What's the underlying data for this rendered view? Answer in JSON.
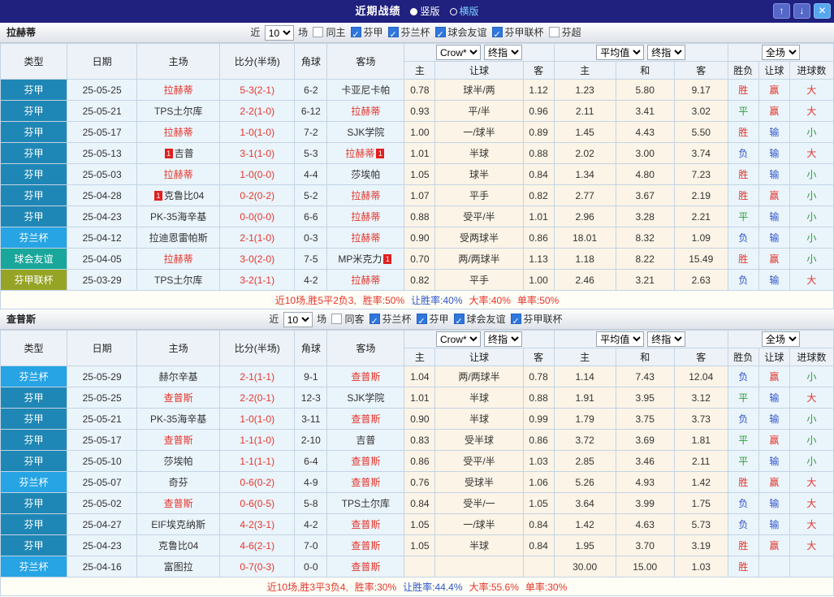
{
  "titlebar": {
    "title": "近期战绩",
    "vertical": "竖版",
    "horizontal": "横版",
    "up_icon": "↑",
    "down_icon": "↓",
    "close_icon": "✕"
  },
  "table_header": {
    "type": "类型",
    "date": "日期",
    "home": "主场",
    "score": "比分(半场)",
    "corner": "角球",
    "away": "客场",
    "crow": "Crow*",
    "final": "终指",
    "avg": "平均值",
    "scope": "全场",
    "h": "主",
    "handicap": "让球",
    "a": "客",
    "d": "和",
    "wdl": "胜负",
    "hc": "让球",
    "goals": "进球数"
  },
  "sections": [
    {
      "team": "拉赫蒂",
      "filter": {
        "near": "近",
        "count": "10",
        "games": "场",
        "checks": [
          {
            "label": "同主",
            "box_cls": ""
          },
          {
            "label": "芬甲",
            "box_cls": "on"
          },
          {
            "label": "芬兰杯",
            "box_cls": "on"
          },
          {
            "label": "球会友谊",
            "box_cls": "on"
          },
          {
            "label": "芬甲联杯",
            "box_cls": "on"
          },
          {
            "label": "芬超",
            "box_cls": ""
          }
        ]
      },
      "rows": [
        {
          "type": "芬甲",
          "type_cls": "tp-fj",
          "date": "25-05-25",
          "home": "拉赫蒂",
          "home_cls": "t-red",
          "home_card": "",
          "score": "5-3(2-1)",
          "corner": "6-2",
          "away": "卡亚尼卡帕",
          "away_cls": "",
          "away_card": "",
          "ch": "0.78",
          "hcap": "球半/两",
          "ca": "1.12",
          "ah": "1.23",
          "ad": "5.80",
          "aa": "9.17",
          "wdl": "胜",
          "wdl_cls": "c-red",
          "hc": "赢",
          "hc_cls": "c-red",
          "ou": "大",
          "ou_cls": "c-red"
        },
        {
          "type": "芬甲",
          "type_cls": "tp-fj",
          "date": "25-05-21",
          "home": "TPS土尔库",
          "home_cls": "",
          "home_card": "",
          "score": "2-2(1-0)",
          "corner": "6-12",
          "away": "拉赫蒂",
          "away_cls": "t-red",
          "away_card": "",
          "ch": "0.93",
          "hcap": "平/半",
          "ca": "0.96",
          "ah": "2.11",
          "ad": "3.41",
          "aa": "3.02",
          "wdl": "平",
          "wdl_cls": "c-green",
          "hc": "赢",
          "hc_cls": "c-red",
          "ou": "大",
          "ou_cls": "c-red"
        },
        {
          "type": "芬甲",
          "type_cls": "tp-fj",
          "date": "25-05-17",
          "home": "拉赫蒂",
          "home_cls": "t-red",
          "home_card": "",
          "score": "1-0(1-0)",
          "corner": "7-2",
          "away": "SJK学院",
          "away_cls": "",
          "away_card": "",
          "ch": "1.00",
          "hcap": "一/球半",
          "ca": "0.89",
          "ah": "1.45",
          "ad": "4.43",
          "aa": "5.50",
          "wdl": "胜",
          "wdl_cls": "c-red",
          "hc": "输",
          "hc_cls": "c-blue",
          "ou": "小",
          "ou_cls": "c-green"
        },
        {
          "type": "芬甲",
          "type_cls": "tp-fj",
          "date": "25-05-13",
          "home": "吉普",
          "home_cls": "",
          "home_card": "1",
          "score": "3-1(1-0)",
          "corner": "5-3",
          "away": "拉赫蒂",
          "away_cls": "t-red",
          "away_card": "1",
          "ch": "1.01",
          "hcap": "半球",
          "ca": "0.88",
          "ah": "2.02",
          "ad": "3.00",
          "aa": "3.74",
          "wdl": "负",
          "wdl_cls": "c-blue",
          "hc": "输",
          "hc_cls": "c-blue",
          "ou": "大",
          "ou_cls": "c-red"
        },
        {
          "type": "芬甲",
          "type_cls": "tp-fj",
          "date": "25-05-03",
          "home": "拉赫蒂",
          "home_cls": "t-red",
          "home_card": "",
          "score": "1-0(0-0)",
          "corner": "4-4",
          "away": "莎埃帕",
          "away_cls": "",
          "away_card": "",
          "ch": "1.05",
          "hcap": "球半",
          "ca": "0.84",
          "ah": "1.34",
          "ad": "4.80",
          "aa": "7.23",
          "wdl": "胜",
          "wdl_cls": "c-red",
          "hc": "输",
          "hc_cls": "c-blue",
          "ou": "小",
          "ou_cls": "c-green"
        },
        {
          "type": "芬甲",
          "type_cls": "tp-fj",
          "date": "25-04-28",
          "home": "克鲁比04",
          "home_cls": "",
          "home_card": "1",
          "score": "0-2(0-2)",
          "corner": "5-2",
          "away": "拉赫蒂",
          "away_cls": "t-red",
          "away_card": "",
          "ch": "1.07",
          "hcap": "平手",
          "ca": "0.82",
          "ah": "2.77",
          "ad": "3.67",
          "aa": "2.19",
          "wdl": "胜",
          "wdl_cls": "c-red",
          "hc": "赢",
          "hc_cls": "c-red",
          "ou": "小",
          "ou_cls": "c-green"
        },
        {
          "type": "芬甲",
          "type_cls": "tp-fj",
          "date": "25-04-23",
          "home": "PK-35海辛基",
          "home_cls": "",
          "home_card": "",
          "score": "0-0(0-0)",
          "corner": "6-6",
          "away": "拉赫蒂",
          "away_cls": "t-red",
          "away_card": "",
          "ch": "0.88",
          "hcap": "受平/半",
          "ca": "1.01",
          "ah": "2.96",
          "ad": "3.28",
          "aa": "2.21",
          "wdl": "平",
          "wdl_cls": "c-green",
          "hc": "输",
          "hc_cls": "c-blue",
          "ou": "小",
          "ou_cls": "c-green"
        },
        {
          "type": "芬兰杯",
          "type_cls": "tp-flb",
          "date": "25-04-12",
          "home": "拉迪恩雷帕斯",
          "home_cls": "",
          "home_card": "",
          "score": "2-1(1-0)",
          "corner": "0-3",
          "away": "拉赫蒂",
          "away_cls": "t-red",
          "away_card": "",
          "ch": "0.90",
          "hcap": "受两球半",
          "ca": "0.86",
          "ah": "18.01",
          "ad": "8.32",
          "aa": "1.09",
          "wdl": "负",
          "wdl_cls": "c-blue",
          "hc": "输",
          "hc_cls": "c-blue",
          "ou": "小",
          "ou_cls": "c-green"
        },
        {
          "type": "球会友谊",
          "type_cls": "tp-qhyy",
          "date": "25-04-05",
          "home": "拉赫蒂",
          "home_cls": "t-red",
          "home_card": "",
          "score": "3-0(2-0)",
          "corner": "7-5",
          "away": "MP米克力",
          "away_cls": "",
          "away_card": "1",
          "ch": "0.70",
          "hcap": "两/两球半",
          "ca": "1.13",
          "ah": "1.18",
          "ad": "8.22",
          "aa": "15.49",
          "wdl": "胜",
          "wdl_cls": "c-red",
          "hc": "赢",
          "hc_cls": "c-red",
          "ou": "小",
          "ou_cls": "c-green"
        },
        {
          "type": "芬甲联杯",
          "type_cls": "tp-fjlb",
          "date": "25-03-29",
          "home": "TPS土尔库",
          "home_cls": "",
          "home_card": "",
          "score": "3-2(1-1)",
          "corner": "4-2",
          "away": "拉赫蒂",
          "away_cls": "t-red",
          "away_card": "",
          "ch": "0.82",
          "hcap": "平手",
          "ca": "1.00",
          "ah": "2.46",
          "ad": "3.21",
          "aa": "2.63",
          "wdl": "负",
          "wdl_cls": "c-blue",
          "hc": "输",
          "hc_cls": "c-blue",
          "ou": "大",
          "ou_cls": "c-red"
        }
      ],
      "summary": [
        {
          "text": "近10场,胜5平2负3,",
          "cls": "c-red"
        },
        {
          "text": "胜率:50%",
          "cls": "c-red"
        },
        {
          "text": "让胜率:40%",
          "cls": "c-blue"
        },
        {
          "text": "大率:40%",
          "cls": "c-red"
        },
        {
          "text": "单率:50%",
          "cls": "c-red"
        }
      ]
    },
    {
      "team": "查普斯",
      "filter": {
        "near": "近",
        "count": "10",
        "games": "场",
        "checks": [
          {
            "label": "同客",
            "box_cls": ""
          },
          {
            "label": "芬兰杯",
            "box_cls": "on"
          },
          {
            "label": "芬甲",
            "box_cls": "on"
          },
          {
            "label": "球会友谊",
            "box_cls": "on"
          },
          {
            "label": "芬甲联杯",
            "box_cls": "on"
          }
        ]
      },
      "rows": [
        {
          "type": "芬兰杯",
          "type_cls": "tp-flb",
          "date": "25-05-29",
          "home": "赫尔辛基",
          "home_cls": "",
          "home_card": "",
          "score": "2-1(1-1)",
          "corner": "9-1",
          "away": "查普斯",
          "away_cls": "t-red",
          "away_card": "",
          "ch": "1.04",
          "hcap": "两/两球半",
          "ca": "0.78",
          "ah": "1.14",
          "ad": "7.43",
          "aa": "12.04",
          "wdl": "负",
          "wdl_cls": "c-blue",
          "hc": "赢",
          "hc_cls": "c-red",
          "ou": "小",
          "ou_cls": "c-green"
        },
        {
          "type": "芬甲",
          "type_cls": "tp-fj",
          "date": "25-05-25",
          "home": "查普斯",
          "home_cls": "t-red",
          "home_card": "",
          "score": "2-2(0-1)",
          "corner": "12-3",
          "away": "SJK学院",
          "away_cls": "",
          "away_card": "",
          "ch": "1.01",
          "hcap": "半球",
          "ca": "0.88",
          "ah": "1.91",
          "ad": "3.95",
          "aa": "3.12",
          "wdl": "平",
          "wdl_cls": "c-green",
          "hc": "输",
          "hc_cls": "c-blue",
          "ou": "大",
          "ou_cls": "c-red"
        },
        {
          "type": "芬甲",
          "type_cls": "tp-fj",
          "date": "25-05-21",
          "home": "PK-35海辛基",
          "home_cls": "",
          "home_card": "",
          "score": "1-0(1-0)",
          "corner": "3-11",
          "away": "查普斯",
          "away_cls": "t-red",
          "away_card": "",
          "ch": "0.90",
          "hcap": "半球",
          "ca": "0.99",
          "ah": "1.79",
          "ad": "3.75",
          "aa": "3.73",
          "wdl": "负",
          "wdl_cls": "c-blue",
          "hc": "输",
          "hc_cls": "c-blue",
          "ou": "小",
          "ou_cls": "c-green"
        },
        {
          "type": "芬甲",
          "type_cls": "tp-fj",
          "date": "25-05-17",
          "home": "查普斯",
          "home_cls": "t-red",
          "home_card": "",
          "score": "1-1(1-0)",
          "corner": "2-10",
          "away": "吉普",
          "away_cls": "",
          "away_card": "",
          "ch": "0.83",
          "hcap": "受半球",
          "ca": "0.86",
          "ah": "3.72",
          "ad": "3.69",
          "aa": "1.81",
          "wdl": "平",
          "wdl_cls": "c-green",
          "hc": "赢",
          "hc_cls": "c-red",
          "ou": "小",
          "ou_cls": "c-green"
        },
        {
          "type": "芬甲",
          "type_cls": "tp-fj",
          "date": "25-05-10",
          "home": "莎埃帕",
          "home_cls": "",
          "home_card": "",
          "score": "1-1(1-1)",
          "corner": "6-4",
          "away": "查普斯",
          "away_cls": "t-red",
          "away_card": "",
          "ch": "0.86",
          "hcap": "受平/半",
          "ca": "1.03",
          "ah": "2.85",
          "ad": "3.46",
          "aa": "2.11",
          "wdl": "平",
          "wdl_cls": "c-green",
          "hc": "输",
          "hc_cls": "c-blue",
          "ou": "小",
          "ou_cls": "c-green"
        },
        {
          "type": "芬兰杯",
          "type_cls": "tp-flb",
          "date": "25-05-07",
          "home": "奇芬",
          "home_cls": "",
          "home_card": "",
          "score": "0-6(0-2)",
          "corner": "4-9",
          "away": "查普斯",
          "away_cls": "t-red",
          "away_card": "",
          "ch": "0.76",
          "hcap": "受球半",
          "ca": "1.06",
          "ah": "5.26",
          "ad": "4.93",
          "aa": "1.42",
          "wdl": "胜",
          "wdl_cls": "c-red",
          "hc": "赢",
          "hc_cls": "c-red",
          "ou": "大",
          "ou_cls": "c-red"
        },
        {
          "type": "芬甲",
          "type_cls": "tp-fj",
          "date": "25-05-02",
          "home": "查普斯",
          "home_cls": "t-red",
          "home_card": "",
          "score": "0-6(0-5)",
          "corner": "5-8",
          "away": "TPS土尔库",
          "away_cls": "",
          "away_card": "",
          "ch": "0.84",
          "hcap": "受半/一",
          "ca": "1.05",
          "ah": "3.64",
          "ad": "3.99",
          "aa": "1.75",
          "wdl": "负",
          "wdl_cls": "c-blue",
          "hc": "输",
          "hc_cls": "c-blue",
          "ou": "大",
          "ou_cls": "c-red"
        },
        {
          "type": "芬甲",
          "type_cls": "tp-fj",
          "date": "25-04-27",
          "home": "EIF埃克纳斯",
          "home_cls": "",
          "home_card": "",
          "score": "4-2(3-1)",
          "corner": "4-2",
          "away": "查普斯",
          "away_cls": "t-red",
          "away_card": "",
          "ch": "1.05",
          "hcap": "一/球半",
          "ca": "0.84",
          "ah": "1.42",
          "ad": "4.63",
          "aa": "5.73",
          "wdl": "负",
          "wdl_cls": "c-blue",
          "hc": "输",
          "hc_cls": "c-blue",
          "ou": "大",
          "ou_cls": "c-red"
        },
        {
          "type": "芬甲",
          "type_cls": "tp-fj",
          "date": "25-04-23",
          "home": "克鲁比04",
          "home_cls": "",
          "home_card": "",
          "score": "4-6(2-1)",
          "corner": "7-0",
          "away": "查普斯",
          "away_cls": "t-red",
          "away_card": "",
          "ch": "1.05",
          "hcap": "半球",
          "ca": "0.84",
          "ah": "1.95",
          "ad": "3.70",
          "aa": "3.19",
          "wdl": "胜",
          "wdl_cls": "c-red",
          "hc": "赢",
          "hc_cls": "c-red",
          "ou": "大",
          "ou_cls": "c-red"
        },
        {
          "type": "芬兰杯",
          "type_cls": "tp-flb",
          "date": "25-04-16",
          "home": "富图拉",
          "home_cls": "",
          "home_card": "",
          "score": "0-7(0-3)",
          "corner": "0-0",
          "away": "查普斯",
          "away_cls": "t-red",
          "away_card": "",
          "ch": "",
          "hcap": "",
          "ca": "",
          "ah": "30.00",
          "ad": "15.00",
          "aa": "1.03",
          "wdl": "胜",
          "wdl_cls": "c-red",
          "hc": "",
          "hc_cls": "",
          "ou": "",
          "ou_cls": ""
        }
      ],
      "summary": [
        {
          "text": "近10场,胜3平3负4,",
          "cls": "c-red"
        },
        {
          "text": "胜率:30%",
          "cls": "c-red"
        },
        {
          "text": "让胜率:44.4%",
          "cls": "c-blue"
        },
        {
          "text": "大率:55.6%",
          "cls": "c-red"
        },
        {
          "text": "单率:30%",
          "cls": "c-red"
        }
      ]
    }
  ]
}
